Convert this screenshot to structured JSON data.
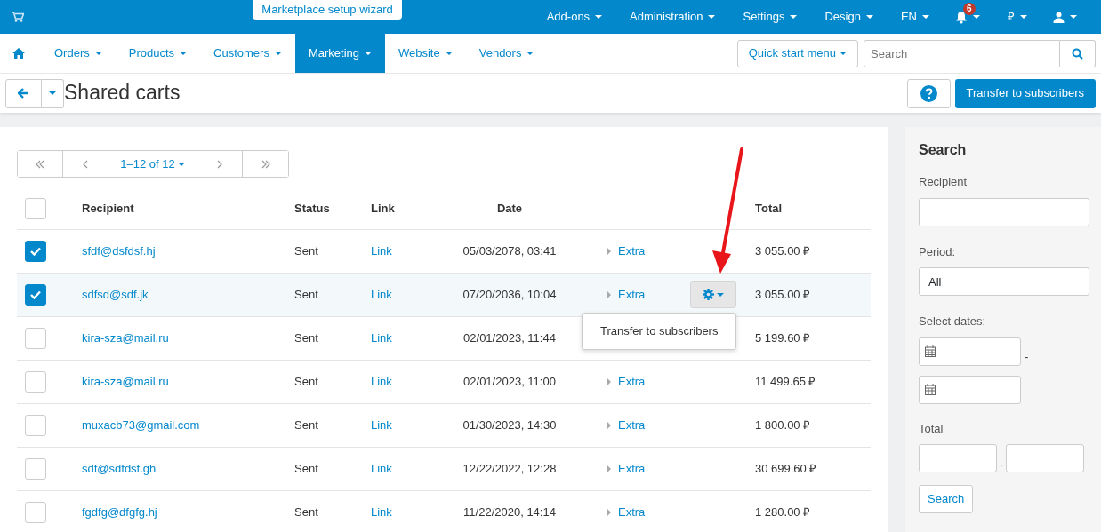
{
  "top_bar": {
    "wizard": "Marketplace setup wizard",
    "menus": [
      {
        "kind": "text",
        "label": "Add-ons"
      },
      {
        "kind": "text",
        "label": "Administration"
      },
      {
        "kind": "text",
        "label": "Settings"
      },
      {
        "kind": "text",
        "label": "Design"
      },
      {
        "kind": "text",
        "label": "EN"
      },
      {
        "kind": "bell",
        "badge": "6"
      },
      {
        "kind": "text",
        "label": "₽"
      },
      {
        "kind": "user"
      }
    ]
  },
  "nav": {
    "items": [
      {
        "label": "Orders",
        "selected": false
      },
      {
        "label": "Products",
        "selected": false
      },
      {
        "label": "Customers",
        "selected": false
      },
      {
        "label": "Marketing",
        "selected": true
      },
      {
        "label": "Website",
        "selected": false
      },
      {
        "label": "Vendors",
        "selected": false
      }
    ],
    "quick_start": "Quick start menu",
    "search": {
      "placeholder": "Search"
    }
  },
  "page": {
    "title": "Shared carts",
    "action": "Transfer to subscribers"
  },
  "pagination": {
    "range": "1–12 of 12"
  },
  "table": {
    "columns": [
      "Recipient",
      "Status",
      "Link",
      "Date",
      "Total"
    ],
    "all_checked": false,
    "rows": [
      {
        "checked": true,
        "recipient": "sfdf@dsfdsf.hj",
        "status": "Sent",
        "link": "Link",
        "date": "05/03/2078, 03:41",
        "extra": "Extra",
        "total": "3 055.00 ₽"
      },
      {
        "checked": true,
        "recipient": "sdfsd@sdf.jk",
        "status": "Sent",
        "link": "Link",
        "date": "07/20/2036, 10:04",
        "extra": "Extra",
        "total": "3 055.00 ₽",
        "actions": {
          "expanded": true,
          "menu": [
            "Transfer to subscribers"
          ]
        }
      },
      {
        "checked": false,
        "recipient": "kira-sza@mail.ru",
        "status": "Sent",
        "link": "Link",
        "date": "02/01/2023, 11:44",
        "total": "5 199.60 ₽"
      },
      {
        "checked": false,
        "recipient": "kira-sza@mail.ru",
        "status": "Sent",
        "link": "Link",
        "date": "02/01/2023, 11:00",
        "extra": "Extra",
        "total": "11 499.65 ₽"
      },
      {
        "checked": false,
        "recipient": "muxacb73@gmail.com",
        "status": "Sent",
        "link": "Link",
        "date": "01/30/2023, 14:30",
        "extra": "Extra",
        "total": "1 800.00 ₽"
      },
      {
        "checked": false,
        "recipient": "sdf@sdfdsf.gh",
        "status": "Sent",
        "link": "Link",
        "date": "12/22/2022, 12:28",
        "extra": "Extra",
        "total": "30 699.60 ₽"
      },
      {
        "checked": false,
        "recipient": "fgdfg@dfgfg.hj",
        "status": "Sent",
        "link": "Link",
        "date": "11/22/2020, 14:14",
        "extra": "Extra",
        "total": "1 280.00 ₽"
      }
    ]
  },
  "sidebar": {
    "title": "Search",
    "recipient_label": "Recipient",
    "period_label": "Period:",
    "period_value": "All",
    "dates_label": "Select dates:",
    "dates_separator": "-",
    "total_label": "Total",
    "total_separator": "-",
    "button": "Search"
  }
}
